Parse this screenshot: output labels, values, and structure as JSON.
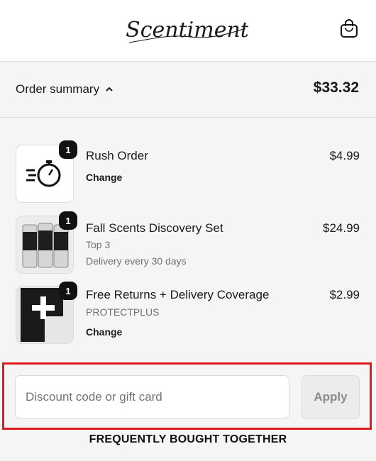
{
  "header": {
    "logo_text": "Scentiment",
    "bag_icon": "shopping-bag-icon"
  },
  "summary": {
    "label": "Order summary",
    "toggle_icon": "chevron-up-icon",
    "total": "$33.32"
  },
  "items": [
    {
      "qty": "1",
      "name": "Rush Order",
      "lines": [],
      "action": "Change",
      "price": "$4.99",
      "icon": "stopwatch-icon"
    },
    {
      "qty": "1",
      "name": "Fall Scents Discovery Set",
      "lines": [
        "Top 3",
        "Delivery every 30 days"
      ],
      "action": "",
      "price": "$24.99",
      "icon": "product-bottles-image"
    },
    {
      "qty": "1",
      "name": "Free Returns + Delivery Coverage",
      "lines": [
        "PROTECTPLUS"
      ],
      "action": "Change",
      "price": "$2.99",
      "icon": "protectplus-logo"
    }
  ],
  "discount": {
    "placeholder": "Discount code or gift card",
    "value": "",
    "apply_label": "Apply"
  },
  "section_heading": "FREQUENTLY BOUGHT TOGETHER",
  "colors": {
    "highlight_border": "#e01a1a",
    "badge_bg": "#111111",
    "page_bg": "#f5f5f5"
  }
}
